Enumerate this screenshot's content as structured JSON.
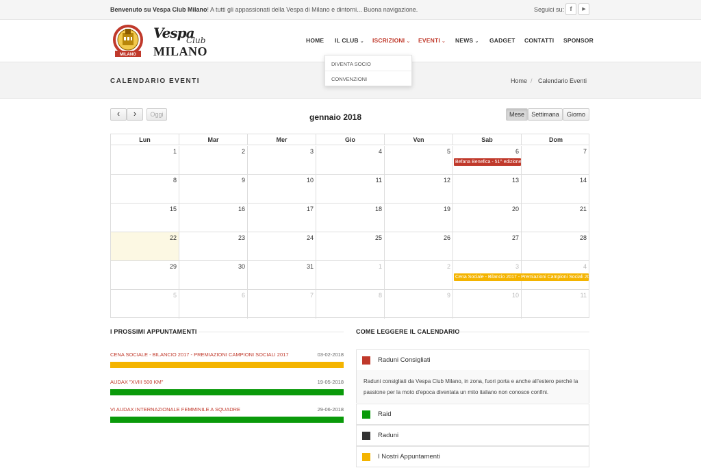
{
  "topbar": {
    "welcome_bold": "Benvenuto su Vespa Club Milano",
    "welcome_rest": "! A tutti gli appassionati della Vespa di Milano e dintorni... Buona navigazione.",
    "follow": "Seguici su:",
    "social": [
      {
        "icon": "facebook-icon",
        "glyph": "f"
      },
      {
        "icon": "youtube-icon",
        "glyph": "▶"
      }
    ]
  },
  "logo": {
    "line1": "Vespa",
    "line2": "Club",
    "line3": "MILANO",
    "badge": "MILANO"
  },
  "nav": [
    {
      "label": "HOME",
      "active": false,
      "caret": false
    },
    {
      "label": "IL CLUB",
      "active": false,
      "caret": true
    },
    {
      "label": "ISCRIZIONI",
      "active": true,
      "caret": true
    },
    {
      "label": "EVENTI",
      "active": true,
      "caret": true
    },
    {
      "label": "NEWS",
      "active": false,
      "caret": true
    },
    {
      "label": "GADGET",
      "active": false,
      "caret": false
    },
    {
      "label": "CONTATTI",
      "active": false,
      "caret": false
    },
    {
      "label": "SPONSOR",
      "active": false,
      "caret": false
    }
  ],
  "dropdown": [
    "DIVENTA SOCIO",
    "CONVENZIONI"
  ],
  "page": {
    "title": "CALENDARIO EVENTI",
    "breadcrumb": [
      "Home",
      "/",
      "Calendario Eventi"
    ]
  },
  "calendar": {
    "title": "gennaio 2018",
    "prev": "‹",
    "next": "›",
    "today": "Oggi",
    "views": [
      "Mese",
      "Settimana",
      "Giorno"
    ],
    "active_view": "Mese",
    "weekdays": [
      "Lun",
      "Mar",
      "Mer",
      "Gio",
      "Ven",
      "Sab",
      "Dom"
    ],
    "weeks": [
      [
        "1",
        "2",
        "3",
        "4",
        "5",
        "6",
        "7"
      ],
      [
        "8",
        "9",
        "10",
        "11",
        "12",
        "13",
        "14"
      ],
      [
        "15",
        "16",
        "17",
        "18",
        "19",
        "20",
        "21"
      ],
      [
        "22",
        "23",
        "24",
        "25",
        "26",
        "27",
        "28"
      ],
      [
        "29",
        "30",
        "31",
        "1",
        "2",
        "3",
        "4"
      ],
      [
        "5",
        "6",
        "7",
        "8",
        "9",
        "10",
        "11"
      ]
    ],
    "other_month_from": {
      "week": 4,
      "day": 3
    },
    "today_cell": {
      "week": 3,
      "day": 0
    },
    "events": [
      {
        "title": "Befana Benefica - 51^ edizione",
        "week": 0,
        "day": 5,
        "span": 1,
        "color": "#c0392b"
      },
      {
        "title": "Cena Sociale - Bilancio 2017 - Premiazioni Campioni Sociali 2017",
        "week": 4,
        "day": 5,
        "span": 2,
        "color": "#f4b400"
      }
    ]
  },
  "upcoming": {
    "heading": "I PROSSIMI APPUNTAMENTI",
    "items": [
      {
        "title": "CENA SOCIALE - BILANCIO 2017 - PREMIAZIONI CAMPIONI SOCIALI 2017",
        "date": "03-02-2018",
        "color": "#f4b400"
      },
      {
        "title": "AUDAX \"XVIII 500 KM\"",
        "date": "19-05-2018",
        "color": "#0a9a0a"
      },
      {
        "title": "VI AUDAX INTERNAZIONALE FEMMINILE A SQUADRE",
        "date": "29-06-2018",
        "color": "#0a9a0a"
      }
    ]
  },
  "legend": {
    "heading": "COME LEGGERE IL CALENDARIO",
    "items": [
      {
        "label": "Raduni Consigliati",
        "color": "#c0392b"
      },
      {
        "label": "Raid",
        "color": "#0a9a0a"
      },
      {
        "label": "Raduni",
        "color": "#333333"
      },
      {
        "label": "I Nostri Appuntamenti",
        "color": "#f4b400"
      }
    ],
    "description": "Raduni consigliati da Vespa Club Milano, in zona, fuori porta e anche all'estero perché la passione per la moto d'epoca diventata un mito italiano non conosce confini."
  }
}
